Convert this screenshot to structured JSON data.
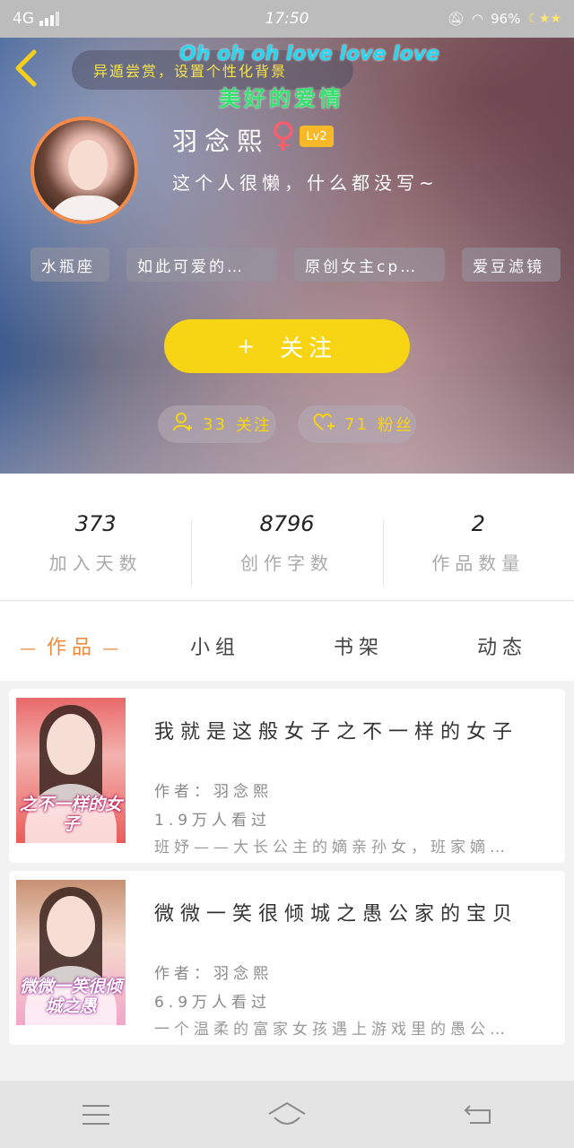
{
  "status_bar": {
    "network": "4G",
    "time": "17:50",
    "battery": "96%",
    "icons": [
      "signal-bars-icon",
      "mute-icon",
      "wifi-icon",
      "moon-stars-icon"
    ]
  },
  "header": {
    "lyric_pill_text": "异遁尝赏，设置个性化背景",
    "lyric_line_1": "Oh oh oh love love love",
    "lyric_line_2": "美好的爱情",
    "username": "羽念熙",
    "level": "Lv2",
    "bio": "这个人很懒，什么都没写~",
    "tags": [
      "水瓶座",
      "如此可爱的…",
      "原创女主cp…",
      "爱豆滤镜"
    ],
    "follow_button": "关注",
    "following": {
      "count": "33",
      "label": "关注"
    },
    "fans": {
      "count": "71",
      "label": "粉丝"
    }
  },
  "stats": [
    {
      "value": "373",
      "label": "加入天数"
    },
    {
      "value": "8796",
      "label": "创作字数"
    },
    {
      "value": "2",
      "label": "作品数量"
    }
  ],
  "tabs": [
    {
      "label": "作品",
      "active": true
    },
    {
      "label": "小组",
      "active": false
    },
    {
      "label": "书架",
      "active": false
    },
    {
      "label": "动态",
      "active": false
    }
  ],
  "works": [
    {
      "title": "我就是这般女子之不一样的女子",
      "cover_text": "之不一样的女子",
      "author": "作者：羽念熙",
      "views": "1.9万人看过",
      "desc": "班妤——大长公主的嫡亲孙女，班家嫡…"
    },
    {
      "title": "微微一笑很倾城之愚公家的宝贝",
      "cover_text": "微微一笑很倾城之愚",
      "author": "作者：羽念熙",
      "views": "6.9万人看过",
      "desc": "一个温柔的富家女孩遇上游戏里的愚公…"
    }
  ],
  "colors": {
    "accent_yellow": "#f7d414",
    "tab_active": "#f08a3c",
    "gender_pink": "#ff5d6c",
    "avatar_border": "#f28a4a"
  }
}
